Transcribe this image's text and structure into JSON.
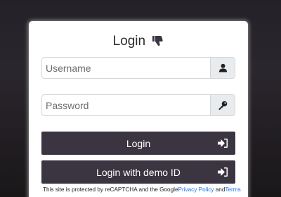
{
  "login_form": {
    "title": "Login",
    "title_icon": "thumbs-down-icon",
    "username": {
      "value": "",
      "placeholder": "Username",
      "icon": "user-icon"
    },
    "password": {
      "value": "",
      "placeholder": "Password",
      "icon": "key-icon"
    },
    "login_button": {
      "label": "Login",
      "icon": "sign-in-icon"
    },
    "demo_button": {
      "label": "Login with demo ID",
      "icon": "sign-in-icon"
    },
    "recaptcha": {
      "text": "This site is protected by reCAPTCHA and the Google",
      "privacy_link": "Privacy Policy",
      "and_text": " and",
      "terms_link": "Terms"
    }
  },
  "colors": {
    "button_bg": "#3b3441",
    "addon_bg": "#e9ecef",
    "link": "#1a73e8",
    "background": "#252128"
  }
}
